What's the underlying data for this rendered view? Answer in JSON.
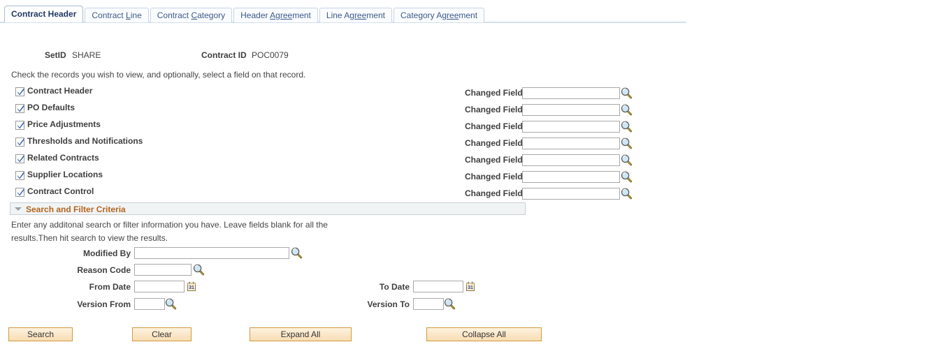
{
  "tabs": [
    {
      "label": "Contract Header",
      "accel": "",
      "active": true
    },
    {
      "label": "Contract Line",
      "accel": "L",
      "active": false
    },
    {
      "label": "Contract Category",
      "accel": "C",
      "active": false
    },
    {
      "label": "Header Agreement",
      "accel": "A",
      "active": false
    },
    {
      "label": "Line Agreement",
      "accel": "g",
      "active": false
    },
    {
      "label": "Category Agreement",
      "accel": "re",
      "active": false
    }
  ],
  "header": {
    "setid_label": "SetID",
    "setid_value": "SHARE",
    "contract_id_label": "Contract ID",
    "contract_id_value": "POC0079"
  },
  "instruction": "Check the records you wish to view, and optionally, select a field on that record.",
  "records": [
    {
      "label": "Contract Header",
      "checked": true,
      "changed_field_label": "Changed Field",
      "changed_field_value": "",
      "lookup_icon": "magnifier-icon"
    },
    {
      "label": "PO Defaults",
      "checked": true,
      "changed_field_label": "Changed Field",
      "changed_field_value": "",
      "lookup_icon": "magnifier-icon"
    },
    {
      "label": "Price Adjustments",
      "checked": true,
      "changed_field_label": "Changed Field",
      "changed_field_value": "",
      "lookup_icon": "magnifier-icon"
    },
    {
      "label": "Thresholds and Notifications",
      "checked": true,
      "changed_field_label": "Changed Field",
      "changed_field_value": "",
      "lookup_icon": "magnifier-icon"
    },
    {
      "label": "Related Contracts",
      "checked": true,
      "changed_field_label": "Changed Field",
      "changed_field_value": "",
      "lookup_icon": "magnifier-icon"
    },
    {
      "label": "Supplier Locations",
      "checked": true,
      "changed_field_label": "Changed Field",
      "changed_field_value": "",
      "lookup_icon": "magnifier-icon"
    },
    {
      "label": "Contract Control",
      "checked": true,
      "changed_field_label": "Changed Field",
      "changed_field_value": "",
      "lookup_icon": "magnifier-icon"
    }
  ],
  "search_section": {
    "title": "Search and Filter Criteria",
    "collapse_icon": "triangle-down-icon",
    "expanded": true,
    "description_line1": "Enter any additonal search or filter information you have. Leave fields blank for all the",
    "description_line2": "results.Then hit search to view the results.",
    "title_color": "#b5651d",
    "fields": {
      "modified_by": {
        "label": "Modified By",
        "value": "",
        "icon": "magnifier-icon"
      },
      "reason_code": {
        "label": "Reason Code",
        "value": "",
        "icon": "magnifier-icon"
      },
      "from_date": {
        "label": "From Date",
        "value": "",
        "icon": "calendar-icon"
      },
      "to_date": {
        "label": "To Date",
        "value": "",
        "icon": "calendar-icon"
      },
      "version_from": {
        "label": "Version From",
        "value": "",
        "icon": "magnifier-icon"
      },
      "version_to": {
        "label": "Version To",
        "value": "",
        "icon": "magnifier-icon"
      }
    }
  },
  "buttons": {
    "search": "Search",
    "clear": "Clear",
    "expand_all": "Expand All",
    "collapse_all": "Collapse All"
  },
  "colors": {
    "tab_active_text": "#203864",
    "tab_text": "#3c5a8a",
    "section_header_text": "#b5651d",
    "button_border": "#d19a3f",
    "button_fill": "#fbe6c7"
  }
}
